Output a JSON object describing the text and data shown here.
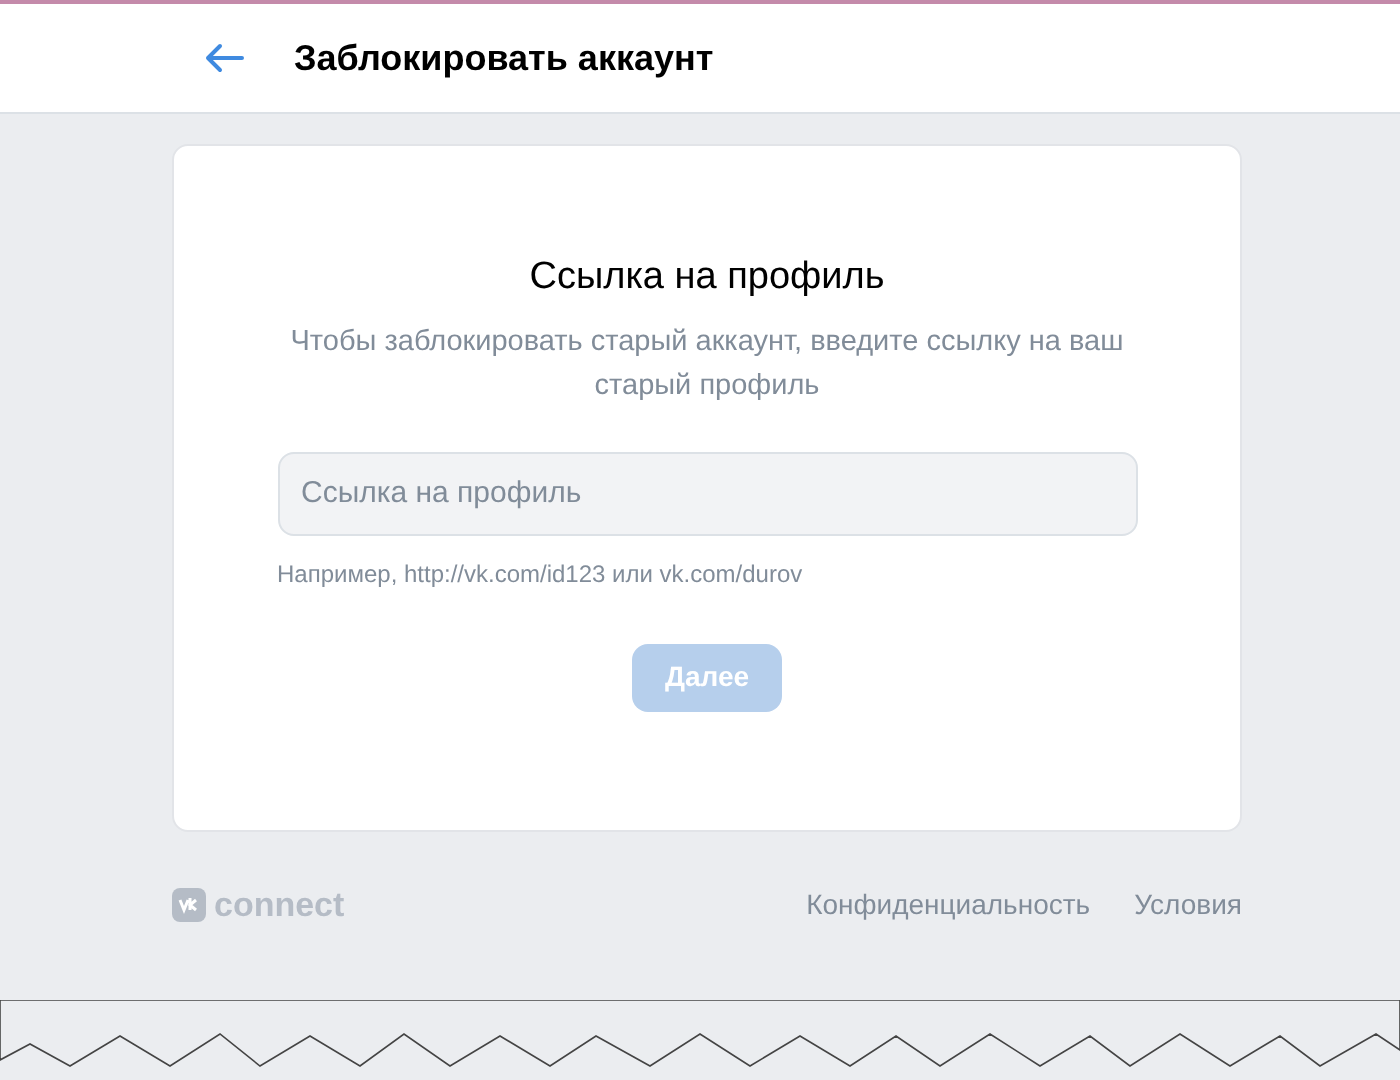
{
  "header": {
    "title": "Заблокировать аккаунт"
  },
  "card": {
    "title": "Ссылка на профиль",
    "description": "Чтобы заблокировать старый аккаунт, введите ссылку на ваш старый профиль",
    "field": {
      "placeholder": "Ссылка на профиль"
    },
    "hint": "Например, http://vk.com/id123 или vk.com/durov",
    "button": {
      "label": "Далее",
      "disabled": true
    }
  },
  "footer": {
    "logo_text": "connect",
    "links": [
      "Конфиденциальность",
      "Условия"
    ]
  }
}
